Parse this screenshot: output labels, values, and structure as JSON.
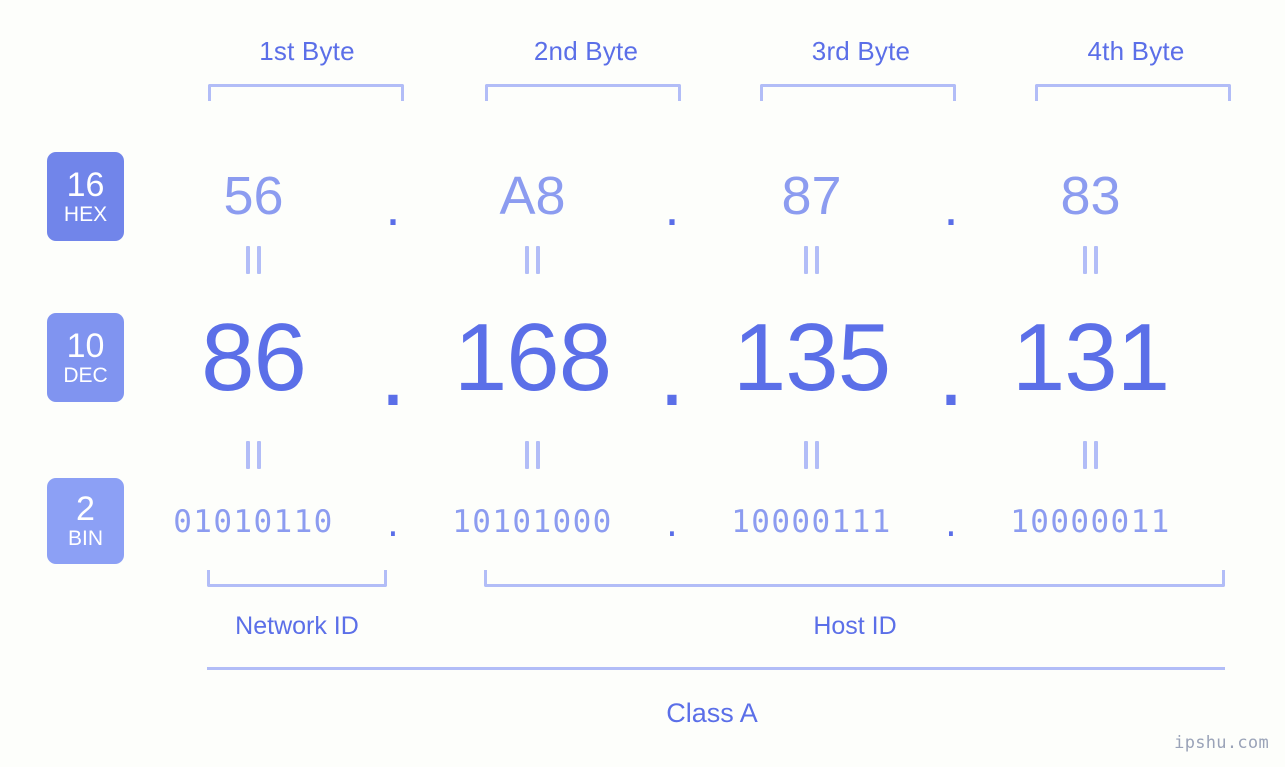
{
  "background_color": "#fdfefb",
  "accent_dark": "#5b6fe8",
  "accent_light": "#8c9cf0",
  "accent_pale": "#b2bdf7",
  "byte_headers": [
    {
      "label": "1st Byte"
    },
    {
      "label": "2nd Byte"
    },
    {
      "label": "3rd Byte"
    },
    {
      "label": "4th Byte"
    }
  ],
  "rows": {
    "hex": {
      "badge_number": "16",
      "badge_name": "HEX",
      "badge_color": "#7185ea",
      "values": [
        "56",
        "A8",
        "87",
        "83"
      ],
      "separator": "."
    },
    "dec": {
      "badge_number": "10",
      "badge_name": "DEC",
      "badge_color": "#8094f0",
      "values": [
        "86",
        "168",
        "135",
        "131"
      ],
      "separator": "."
    },
    "bin": {
      "badge_number": "2",
      "badge_name": "BIN",
      "badge_color": "#8ca0f5",
      "values": [
        "01010110",
        "10101000",
        "10000111",
        "10000011"
      ],
      "separator": "."
    }
  },
  "equality_symbol": "||",
  "sections": {
    "network_id": "Network ID",
    "host_id": "Host ID",
    "class": "Class A"
  },
  "watermark": "ipshu.com"
}
